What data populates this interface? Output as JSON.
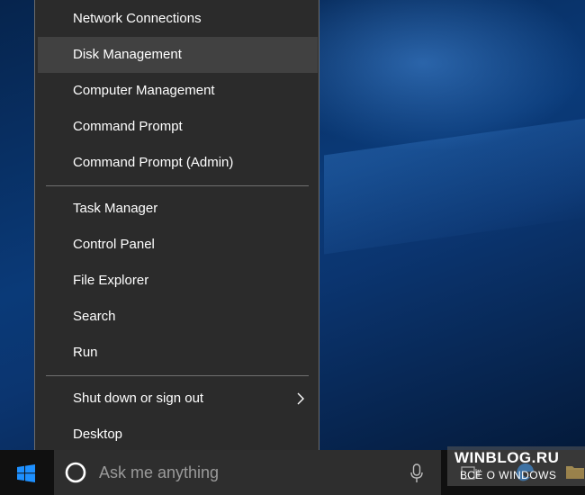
{
  "menu": {
    "items": [
      {
        "label": "Network Connections"
      },
      {
        "label": "Disk Management"
      },
      {
        "label": "Computer Management"
      },
      {
        "label": "Command Prompt"
      },
      {
        "label": "Command Prompt (Admin)"
      },
      {
        "label": "Task Manager"
      },
      {
        "label": "Control Panel"
      },
      {
        "label": "File Explorer"
      },
      {
        "label": "Search"
      },
      {
        "label": "Run"
      },
      {
        "label": "Shut down or sign out"
      },
      {
        "label": "Desktop"
      }
    ],
    "highlighted_item": "Disk Management",
    "shutdown_has_submenu_icon": "chevron-right-icon"
  },
  "taskbar": {
    "search_placeholder": "Ask me anything",
    "icons": [
      "windows-logo-icon",
      "cortana-icon",
      "microphone-icon",
      "task-view-icon",
      "edge-icon",
      "file-explorer-icon"
    ]
  },
  "watermark": {
    "line1": "WINBLOG.RU",
    "line2": "ВСЁ О WINDOWS"
  },
  "colors": {
    "menu_bg": "#2b2b2b",
    "menu_hover": "#414141",
    "taskbar_bg": "#101010",
    "search_bg": "#2e2e2e",
    "accent": "#1e90ff"
  }
}
